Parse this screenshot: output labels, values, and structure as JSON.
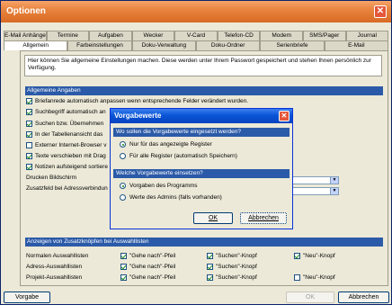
{
  "window": {
    "title": "Optionen"
  },
  "tabs_row1": [
    "E-Mail Anhänge",
    "Termine",
    "Aufgaben",
    "Wecker",
    "V-Card",
    "Telefon-CD",
    "Modem",
    "SMS/Pager",
    "Journal"
  ],
  "tabs_row2": [
    "Allgemein",
    "Farbeinstellungen",
    "Doku-Verwaltung",
    "Doku-Ordner",
    "Serienbriefe",
    "E-Mail"
  ],
  "info_text": "Hier können Sie allgemeine Einstellungen machen. Diese werden unter Ihrem Passwort gespeichert und stehen Ihnen persönlich zur Verfügung.",
  "general": {
    "header": "Allgemeine Angaben",
    "checkboxes": [
      "Briefanrede automatisch anpassen wenn entsprechende Felder verändert wurden.",
      "Suchbegriff automatisch an",
      "Suchen bzw. Übernehmen",
      "In der Tabellenansicht das",
      "Externer Internet-Browser v",
      "Texte verschieben mit Drag",
      "Notizen aufsteigend sortiere"
    ],
    "print_label": "Drucken Bildschirm",
    "extra_field_label": "Zusatzfeld bei Adressverbindun"
  },
  "quickbuttons": {
    "header": "Anzeigen von Zusatzknöpfen bei Auswahllisten",
    "rows": [
      {
        "label": "Normalen Auswahllisten",
        "opts": [
          "\"Gehe nach\"-Pfeil",
          "\"Suchen\"-Knopf",
          "\"Neu\"-Knopf"
        ]
      },
      {
        "label": "Adress-Auswahllisten",
        "opts": [
          "\"Gehe nach\"-Pfeil",
          "\"Suchen\"-Knopf"
        ]
      },
      {
        "label": "Projekt-Auswahllisten",
        "opts": [
          "\"Gehe nach\"-Pfeil",
          "\"Suchen\"-Knopf",
          "\"Neu\"-Knopf"
        ]
      }
    ]
  },
  "buttons": {
    "defaults": "Vorgabe",
    "ok": "OK",
    "cancel": "Abbrechen"
  },
  "dialog": {
    "title": "Vorgabewerte",
    "group1": "Wo sollen die Vorgabewerte eingesetzt werden?",
    "radio1a": "Nur für das angezeigte Register",
    "radio1b": "Für alle Register (automatisch Speichern)",
    "group2": "Welche Vorgabewerte einsetzen?",
    "radio2a": "Vorgaben des Programms",
    "radio2b": "Werte des Admins (falls vorhanden)",
    "ok": "OK",
    "cancel": "Abbrechen"
  }
}
